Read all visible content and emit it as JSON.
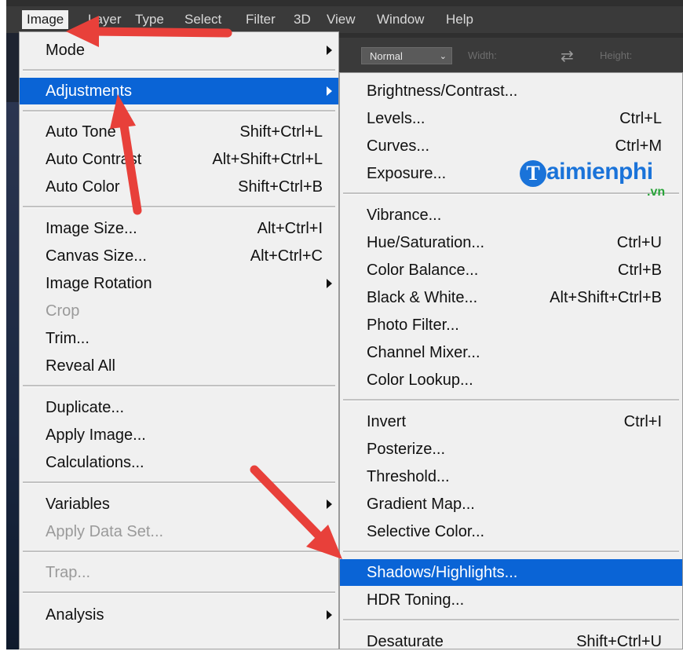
{
  "menubar": {
    "items": [
      "Image",
      "Layer",
      "Type",
      "Select",
      "Filter",
      "3D",
      "View",
      "Window",
      "Help"
    ]
  },
  "options_bar": {
    "mode_value": "Normal",
    "width_label": "Width:",
    "height_label": "Height:"
  },
  "image_menu": {
    "items": [
      {
        "label": "Mode",
        "shortcut": "",
        "submenu": true
      },
      {
        "label": "Adjustments",
        "shortcut": "",
        "submenu": true,
        "highlighted": true
      },
      {
        "label": "Auto Tone",
        "shortcut": "Shift+Ctrl+L"
      },
      {
        "label": "Auto Contrast",
        "shortcut": "Alt+Shift+Ctrl+L"
      },
      {
        "label": "Auto Color",
        "shortcut": "Shift+Ctrl+B"
      },
      {
        "label": "Image Size...",
        "shortcut": "Alt+Ctrl+I"
      },
      {
        "label": "Canvas Size...",
        "shortcut": "Alt+Ctrl+C"
      },
      {
        "label": "Image Rotation",
        "shortcut": "",
        "submenu": true
      },
      {
        "label": "Crop",
        "shortcut": "",
        "disabled": true
      },
      {
        "label": "Trim...",
        "shortcut": ""
      },
      {
        "label": "Reveal All",
        "shortcut": ""
      },
      {
        "label": "Duplicate...",
        "shortcut": ""
      },
      {
        "label": "Apply Image...",
        "shortcut": ""
      },
      {
        "label": "Calculations...",
        "shortcut": ""
      },
      {
        "label": "Variables",
        "shortcut": "",
        "submenu": true
      },
      {
        "label": "Apply Data Set...",
        "shortcut": "",
        "disabled": true
      },
      {
        "label": "Trap...",
        "shortcut": "",
        "disabled": true
      },
      {
        "label": "Analysis",
        "shortcut": "",
        "submenu": true
      }
    ]
  },
  "adjustments_menu": {
    "items": [
      {
        "label": "Brightness/Contrast...",
        "shortcut": ""
      },
      {
        "label": "Levels...",
        "shortcut": "Ctrl+L"
      },
      {
        "label": "Curves...",
        "shortcut": "Ctrl+M"
      },
      {
        "label": "Exposure...",
        "shortcut": ""
      },
      {
        "label": "Vibrance...",
        "shortcut": ""
      },
      {
        "label": "Hue/Saturation...",
        "shortcut": "Ctrl+U"
      },
      {
        "label": "Color Balance...",
        "shortcut": "Ctrl+B"
      },
      {
        "label": "Black & White...",
        "shortcut": "Alt+Shift+Ctrl+B"
      },
      {
        "label": "Photo Filter...",
        "shortcut": ""
      },
      {
        "label": "Channel Mixer...",
        "shortcut": ""
      },
      {
        "label": "Color Lookup...",
        "shortcut": ""
      },
      {
        "label": "Invert",
        "shortcut": "Ctrl+I"
      },
      {
        "label": "Posterize...",
        "shortcut": ""
      },
      {
        "label": "Threshold...",
        "shortcut": ""
      },
      {
        "label": "Gradient Map...",
        "shortcut": ""
      },
      {
        "label": "Selective Color...",
        "shortcut": ""
      },
      {
        "label": "Shadows/Highlights...",
        "shortcut": "",
        "highlighted": true
      },
      {
        "label": "HDR Toning...",
        "shortcut": ""
      },
      {
        "label": "Desaturate",
        "shortcut": "Shift+Ctrl+U"
      }
    ]
  },
  "watermark": {
    "letter": "T",
    "text": "aimienphi",
    "domain": ".vn"
  },
  "colors": {
    "highlight": "#0a64d6",
    "annotation_arrow": "#e8403a",
    "watermark_blue": "#1a73d9"
  }
}
